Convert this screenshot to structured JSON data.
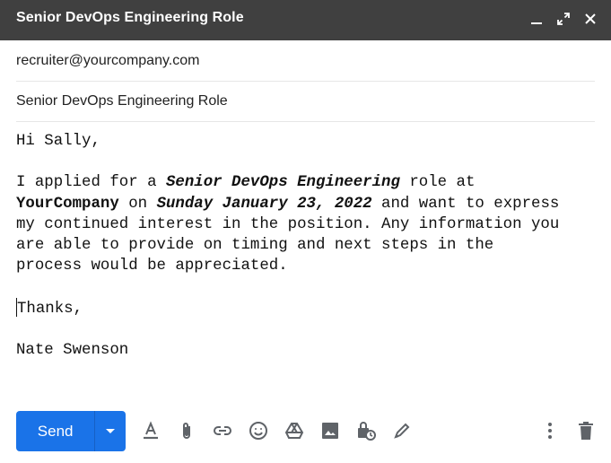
{
  "window": {
    "title": "Senior DevOps Engineering Role",
    "controls": [
      "minimize-icon",
      "expand-icon",
      "close-icon"
    ]
  },
  "fields": {
    "to": "recruiter@yourcompany.com",
    "subject": "Senior DevOps Engineering Role"
  },
  "message": {
    "greeting": "Hi Sally,",
    "p1_a": "I applied for a ",
    "p1_role": "Senior DevOps Engineering",
    "p1_b": " role at",
    "p1_company": "YourCompany",
    "p1_c": " on ",
    "p1_date": "Sunday January 23, 2022",
    "p1_d": " and want to express",
    "p1_line3": "my continued interest in the position. Any information you",
    "p1_line4": "are able to provide on timing and next steps in the",
    "p1_line5": "process would be appreciated.",
    "thanks": "Thanks,",
    "signature": "Nate Swenson"
  },
  "toolbar": {
    "send_label": "Send",
    "accent": "#1a73e8",
    "icons": [
      "format-text-icon",
      "attach-icon",
      "link-icon",
      "emoji-icon",
      "drive-icon",
      "photo-icon",
      "confidential-icon",
      "signature-icon",
      "more-options-icon",
      "trash-icon"
    ]
  }
}
